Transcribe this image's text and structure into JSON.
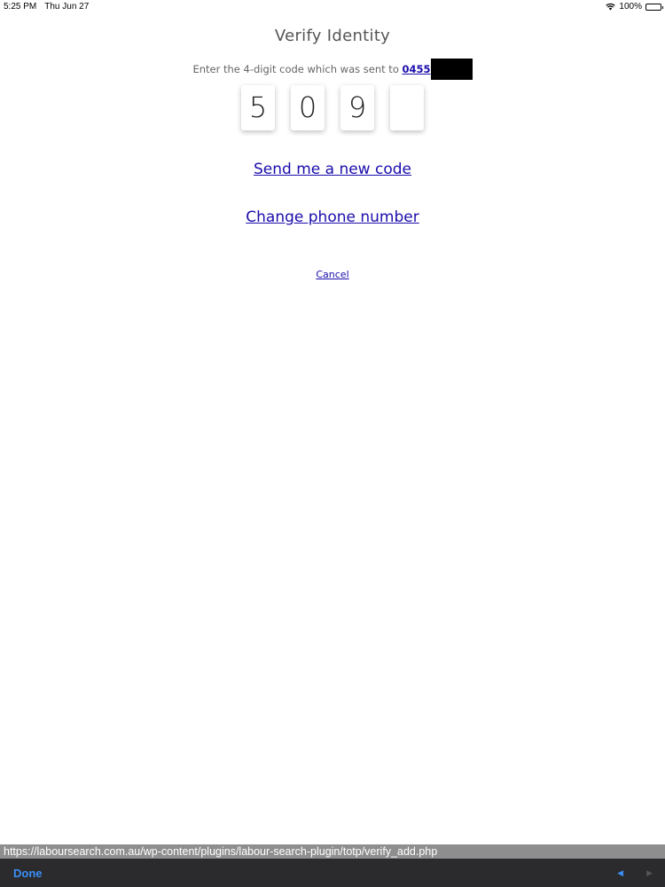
{
  "status": {
    "time": "5:25 PM",
    "date": "Thu Jun 27",
    "battery": "100%"
  },
  "page": {
    "title": "Verify Identity",
    "subtitle_prefix": "Enter the 4-digit code which was sent to ",
    "phone_visible": "0455",
    "code_digits": [
      "5",
      "0",
      "9",
      ""
    ],
    "send_new_code": "Send me a new code",
    "change_phone": "Change phone number",
    "cancel": "Cancel"
  },
  "browser": {
    "url": "https://laboursearch.com.au/wp-content/plugins/labour-search-plugin/totp/verify_add.php",
    "done_label": "Done",
    "back_icon": "◀",
    "forward_icon": "▶"
  },
  "colors": {
    "link": "#1a0dab",
    "toolbar_bg": "#2b2b2d",
    "accent": "#3b8ef5"
  }
}
